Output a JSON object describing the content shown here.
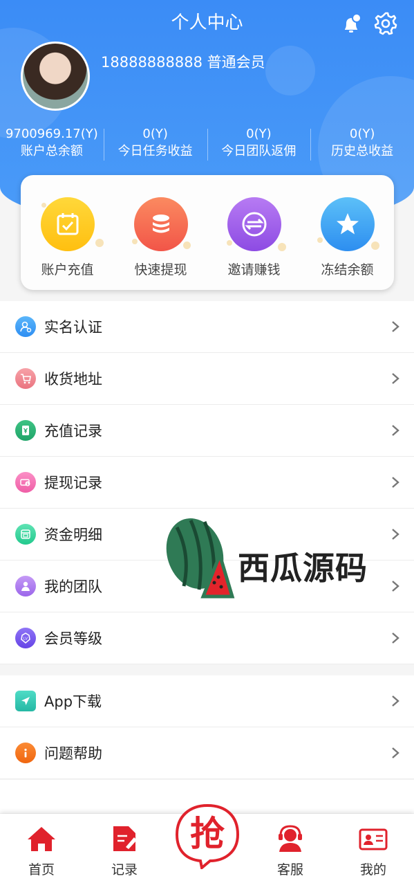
{
  "header": {
    "title": "个人中心",
    "phone": "18888888888",
    "member_level": "普通会员"
  },
  "stats": [
    {
      "value": "9700969.17(Y)",
      "label": "账户总余额"
    },
    {
      "value": "0(Y)",
      "label": "今日任务收益"
    },
    {
      "value": "0(Y)",
      "label": "今日团队返佣"
    },
    {
      "value": "0(Y)",
      "label": "历史总收益"
    }
  ],
  "actions": [
    {
      "label": "账户充值",
      "icon": "calendar-check-icon",
      "color": "#ffc21a"
    },
    {
      "label": "快速提现",
      "icon": "coin-stack-icon",
      "color": "#f96d52"
    },
    {
      "label": "邀请赚钱",
      "icon": "exchange-icon",
      "color": "#a45ee8"
    },
    {
      "label": "冻结余额",
      "icon": "star-icon",
      "color": "#3aa4f3"
    }
  ],
  "menu_main": [
    {
      "label": "实名认证",
      "icon": "user-verify-icon",
      "color": "#3a9ef5"
    },
    {
      "label": "收货地址",
      "icon": "cart-icon",
      "color": "#f08a93"
    },
    {
      "label": "充值记录",
      "icon": "recharge-icon",
      "color": "#2fb57a"
    },
    {
      "label": "提现记录",
      "icon": "withdraw-icon",
      "color": "#f576b4"
    },
    {
      "label": "资金明细",
      "icon": "ledger-icon",
      "color": "#35d39a"
    },
    {
      "label": "我的团队",
      "icon": "team-icon",
      "color": "#b07cf0"
    },
    {
      "label": "会员等级",
      "icon": "level-badge-icon",
      "color": "#7b5cf0"
    }
  ],
  "menu_extra": [
    {
      "label": "App下载",
      "icon": "send-icon",
      "color": "#34c9b5"
    },
    {
      "label": "问题帮助",
      "icon": "info-icon",
      "color": "#f7751f"
    }
  ],
  "watermark": {
    "text": "西瓜源码"
  },
  "tabbar": {
    "home": "首页",
    "records": "记录",
    "grab": "抢",
    "service": "客服",
    "mine": "我的"
  },
  "colors": {
    "primary": "#3b8cf6",
    "tab_red": "#e0222c"
  }
}
